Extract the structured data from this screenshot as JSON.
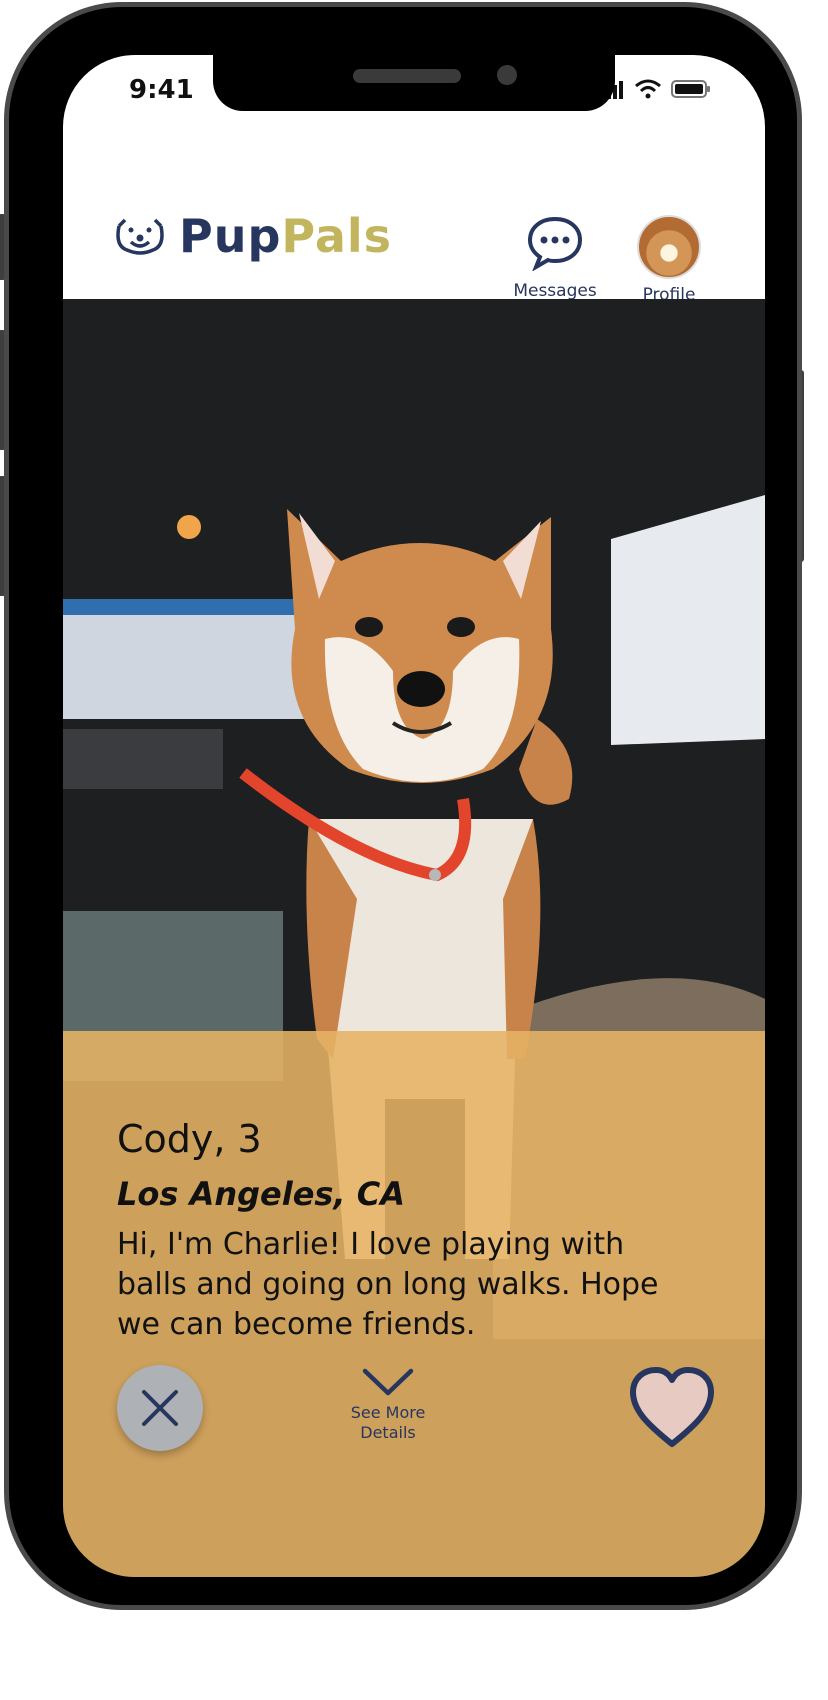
{
  "status_bar": {
    "time": "9:41"
  },
  "header": {
    "logo_part1": "Pup",
    "logo_part2": "Pals",
    "messages_label": "Messages",
    "profile_label": "Profile"
  },
  "card": {
    "name_age": "Cody, 3",
    "location": "Los Angeles, CA",
    "bio": "Hi, I'm Charlie! I love playing with balls and going on long walks. Hope we can become friends."
  },
  "actions": {
    "see_more_line1": "See More",
    "see_more_line2": "Details"
  },
  "colors": {
    "brand_navy": "#27365f",
    "brand_gold": "#c2b55e",
    "card_bg": "#e6b364",
    "heart_fill": "#e7cbc3"
  },
  "icons": [
    "paw-logo-icon",
    "chat-bubble-icon",
    "close-icon",
    "chevron-down-icon",
    "heart-icon",
    "signal-icon",
    "wifi-icon",
    "battery-icon"
  ]
}
